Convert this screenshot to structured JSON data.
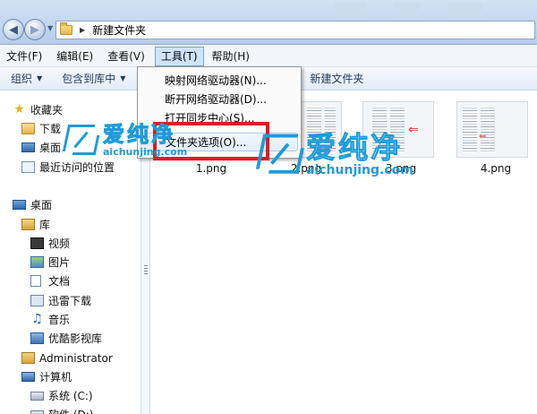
{
  "address": {
    "path": "新建文件夹"
  },
  "menubar": [
    {
      "label": "文件(F)"
    },
    {
      "label": "编辑(E)"
    },
    {
      "label": "查看(V)"
    },
    {
      "label": "工具(T)"
    },
    {
      "label": "帮助(H)"
    }
  ],
  "toolbar": {
    "organize": "组织",
    "include_library": "包含到库中",
    "new_folder": "新建文件夹"
  },
  "tools_menu": [
    {
      "label": "映射网络驱动器(N)..."
    },
    {
      "label": "断开网络驱动器(D)..."
    },
    {
      "label": "打开同步中心(S)..."
    },
    {
      "label": "文件夹选项(O)..."
    }
  ],
  "sidebar": {
    "favorites": "收藏夹",
    "fav_items": [
      "下载",
      "桌面",
      "最近访问的位置"
    ],
    "desktop": "桌面",
    "library": "库",
    "lib_items": [
      "视频",
      "图片",
      "文档",
      "迅雷下载",
      "音乐",
      "优酷影视库"
    ],
    "user": "Administrator",
    "computer": "计算机",
    "drives": [
      "系统 (C:)",
      "软件 (D:)"
    ]
  },
  "files": [
    {
      "name": "1.png"
    },
    {
      "name": "2.png"
    },
    {
      "name": "3.png"
    },
    {
      "name": "4.png"
    }
  ],
  "watermark": {
    "brand_cn": "爱纯净",
    "brand_en": "aichunjing.com"
  },
  "colors": {
    "highlight_box": "#e01a22",
    "watermark": "#1f9bd8",
    "menu_active": "#cfe3fa"
  }
}
